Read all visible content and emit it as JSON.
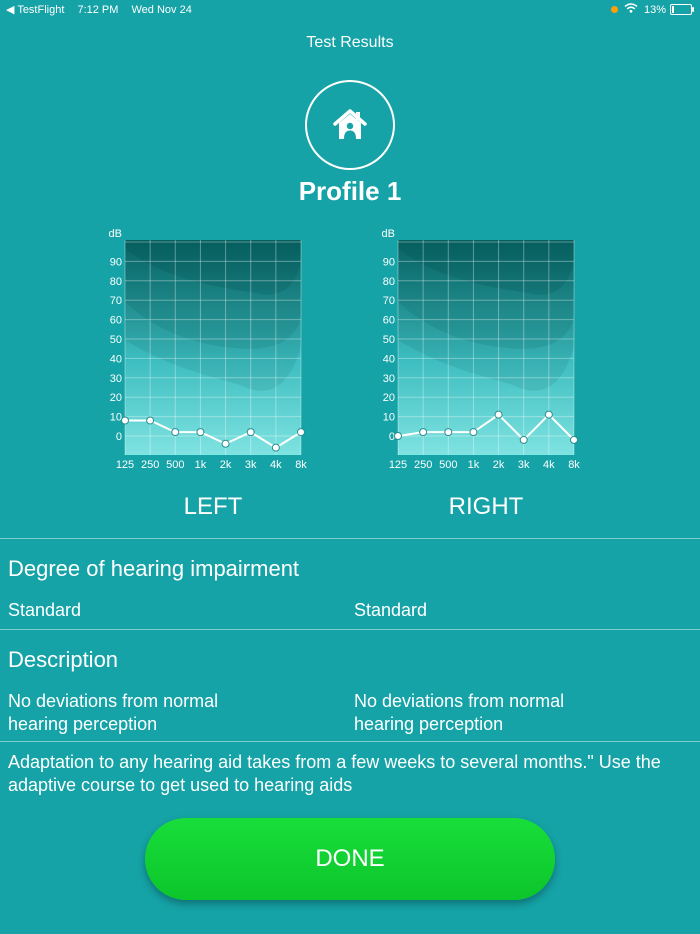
{
  "status_bar": {
    "back_label": "◀ TestFlight",
    "time": "7:12 PM",
    "date": "Wed Nov 24",
    "battery": "13%",
    "battery_level": 0.13
  },
  "header": {
    "title": "Test Results"
  },
  "profile": {
    "icon": "home-icon",
    "name": "Profile 1"
  },
  "charts": [
    {
      "side": "LEFT",
      "unit": "dB",
      "y_ticks": [
        "90",
        "80",
        "70",
        "60",
        "50",
        "40",
        "30",
        "20",
        "10",
        "0"
      ],
      "x_ticks": [
        "125",
        "250",
        "500",
        "1k",
        "2k",
        "3k",
        "4k",
        "8k"
      ],
      "values": [
        8,
        8,
        2,
        2,
        -4,
        2,
        -6,
        2
      ]
    },
    {
      "side": "RIGHT",
      "unit": "dB",
      "y_ticks": [
        "90",
        "80",
        "70",
        "60",
        "50",
        "40",
        "30",
        "20",
        "10",
        "0"
      ],
      "x_ticks": [
        "125",
        "250",
        "500",
        "1k",
        "2k",
        "3k",
        "4k",
        "8k"
      ],
      "values": [
        0,
        2,
        2,
        2,
        11,
        -2,
        11,
        -2
      ]
    }
  ],
  "sections": {
    "degree": {
      "heading": "Degree of hearing impairment",
      "left": "Standard",
      "right": "Standard"
    },
    "description": {
      "heading": "Description",
      "left": "No deviations from normal hearing perception",
      "right": "No deviations from normal hearing perception"
    }
  },
  "note": "Adaptation to any hearing aid takes from a few weeks to several months.\" Use the adaptive course to get used to hearing aids",
  "done_label": "DONE",
  "colors": {
    "background": "#15a3a7",
    "done_button": "#12d433"
  }
}
